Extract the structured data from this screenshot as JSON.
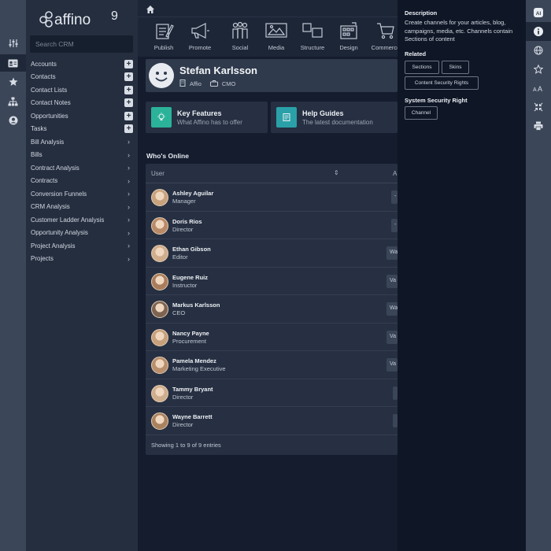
{
  "app": {
    "logo_text": "affino",
    "logo_version": "9"
  },
  "rail_icons": [
    "sliders-icon",
    "contact-card-icon",
    "star-icon",
    "sitemap-icon",
    "user-circle-icon"
  ],
  "search": {
    "placeholder": "Search CRM"
  },
  "sidebar": {
    "items": [
      {
        "label": "Accounts",
        "action": "add"
      },
      {
        "label": "Contacts",
        "action": "add"
      },
      {
        "label": "Contact Lists",
        "action": "add"
      },
      {
        "label": "Contact Notes",
        "action": "add"
      },
      {
        "label": "Opportunities",
        "action": "add"
      },
      {
        "label": "Tasks",
        "action": "add"
      },
      {
        "label": "Bill Analysis",
        "action": "expand"
      },
      {
        "label": "Bills",
        "action": "expand"
      },
      {
        "label": "Contract Analysis",
        "action": "expand"
      },
      {
        "label": "Contracts",
        "action": "expand"
      },
      {
        "label": "Conversion Funnels",
        "action": "expand"
      },
      {
        "label": "CRM Analysis",
        "action": "expand"
      },
      {
        "label": "Customer Ladder Analysis",
        "action": "expand"
      },
      {
        "label": "Opportunity Analysis",
        "action": "expand"
      },
      {
        "label": "Project Analysis",
        "action": "expand"
      },
      {
        "label": "Projects",
        "action": "expand"
      }
    ]
  },
  "toolbar": {
    "items": [
      {
        "label": "Publish",
        "icon": "publish-icon"
      },
      {
        "label": "Promote",
        "icon": "megaphone-icon"
      },
      {
        "label": "Social",
        "icon": "people-icon"
      },
      {
        "label": "Media",
        "icon": "image-icon"
      },
      {
        "label": "Structure",
        "icon": "structure-icon"
      },
      {
        "label": "Design",
        "icon": "design-icon"
      },
      {
        "label": "Commerce",
        "icon": "cart-icon"
      }
    ]
  },
  "profile": {
    "name": "Stefan Karlsson",
    "company": "Affio",
    "role": "CMO"
  },
  "cards": [
    {
      "title": "Key Features",
      "subtitle": "What Affino has to offer",
      "color": "#2bb39a",
      "icon": "lightbulb-icon"
    },
    {
      "title": "Help Guides",
      "subtitle": "The latest documentation",
      "color": "#2aa1a8",
      "icon": "document-icon"
    }
  ],
  "online": {
    "title": "Who's Online",
    "col_user": "User",
    "col_second": "A",
    "users": [
      {
        "name": "Ashley Aguilar",
        "role": "Manager",
        "btn": "-"
      },
      {
        "name": "Doris Rios",
        "role": "Director",
        "btn": "-"
      },
      {
        "name": "Ethan Gibson",
        "role": "Editor",
        "btn": "Wa"
      },
      {
        "name": "Eugene Ruiz",
        "role": "Instructor",
        "btn": "Va"
      },
      {
        "name": "Markus Karlsson",
        "role": "CEO",
        "btn": "Wa"
      },
      {
        "name": "Nancy Payne",
        "role": "Procurement",
        "btn": "Va"
      },
      {
        "name": "Pamela Mendez",
        "role": "Marketing Executive",
        "btn": "Va"
      },
      {
        "name": "Tammy Bryant",
        "role": "Director",
        "btn": ""
      },
      {
        "name": "Wayne Barrett",
        "role": "Director",
        "btn": ""
      }
    ],
    "footer": "Showing 1 to 9 of 9 entries"
  },
  "help_panel": {
    "description_heading": "Description",
    "description": "Create channels for your articles, blog, campaigns, media, etc. Channels contain Sections of content",
    "related_heading": "Related",
    "related_tags": [
      "Sections",
      "Skins",
      "Content Security Rights"
    ],
    "security_heading": "System Security Right",
    "security_tags": [
      "Channel"
    ]
  },
  "right_rail_icons": [
    "ai-icon",
    "info-icon",
    "globe-icon",
    "star-outline-icon",
    "font-size-icon",
    "collapse-icon",
    "print-icon"
  ]
}
